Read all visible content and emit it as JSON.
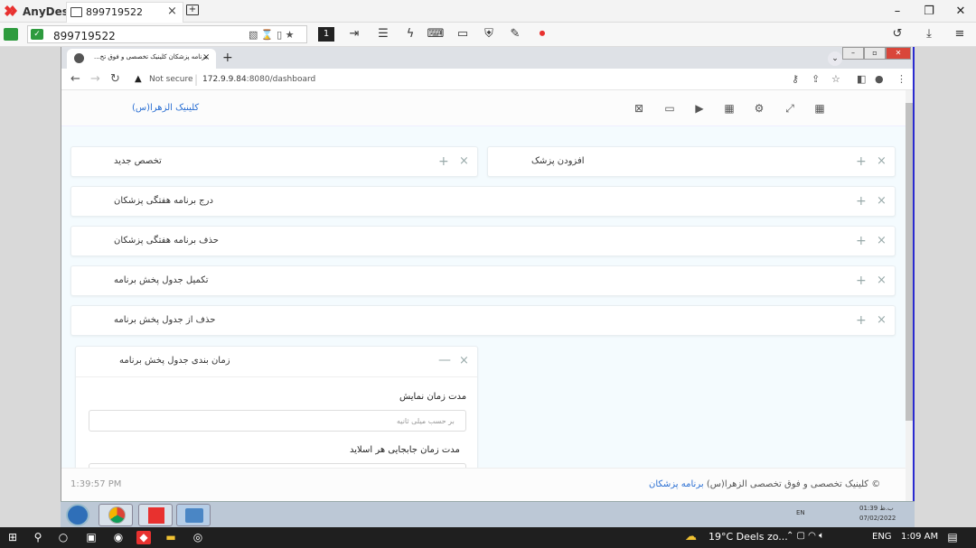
{
  "anydesk": {
    "brand": "AnyDesk",
    "tab_label": "899719522",
    "tab_close": "×",
    "address": "899719522",
    "window_controls": {
      "minimize": "–",
      "maximize": "❐",
      "close": "✕"
    },
    "toolbar_icons": [
      "display-icon",
      "file-transfer-icon",
      "chat-icon",
      "actions-icon",
      "keyboard-icon",
      "monitor-icon",
      "permissions-icon",
      "whiteboard-icon",
      "record-icon",
      "history-icon",
      "download-icon",
      "menu-icon"
    ],
    "monitor_index": "1"
  },
  "browser": {
    "tab_title": "برنامه پزشکان کلینیک تخصصی و فوق تخ...",
    "tab_close": "×",
    "new_tab": "+",
    "security": "Not secure",
    "url_host": "172.9.9.84",
    "url_rest": ":8080/dashboard"
  },
  "app": {
    "brand": "کلینیک الزهرا(س)",
    "header_icons": [
      "close-window-icon",
      "monitor-icon",
      "play-icon",
      "calendar-icon",
      "settings-icon",
      "fullscreen-icon",
      "grid-icon"
    ],
    "panels": {
      "new_specialty": "تخصص جدید",
      "add_doctor": "افزودن پزشک",
      "insert_weekly": "درج برنامه هفتگی پزشکان",
      "delete_weekly": "حذف برنامه هفتگی پزشکان",
      "complete_table": "تکمیل جدول پخش برنامه",
      "delete_table": "حذف از جدول پخش برنامه",
      "schedule": "زمان بندی جدول پخش برنامه"
    },
    "plus": "+",
    "close": "×",
    "minus": "—",
    "form": {
      "display_duration_label": "مدت زمان نمایش",
      "display_duration_placeholder": "بر حسب میلی ثانیه",
      "slide_duration_label": "مدت زمان جابجایی هر اسلاید"
    },
    "footer_time": "1:39:57 PM",
    "footer_copy_link": "برنامه پزشکان",
    "footer_copy_rest": "© کلینیک تخصصی و فوق تخصصی الزهرا(س)"
  },
  "remote_taskbar": {
    "lang": "EN",
    "time": "01:39 ب.ظ",
    "date": "07/02/2022"
  },
  "host_taskbar": {
    "weather": "19°C  Deels zo...",
    "lang": "ENG",
    "clock": "1:09 AM"
  },
  "colors": {
    "accent": "#2a6fd3",
    "anydesk_red": "#e8312f",
    "app_bg": "#f4fbfe",
    "scroll_border": "#2b2bd0"
  }
}
